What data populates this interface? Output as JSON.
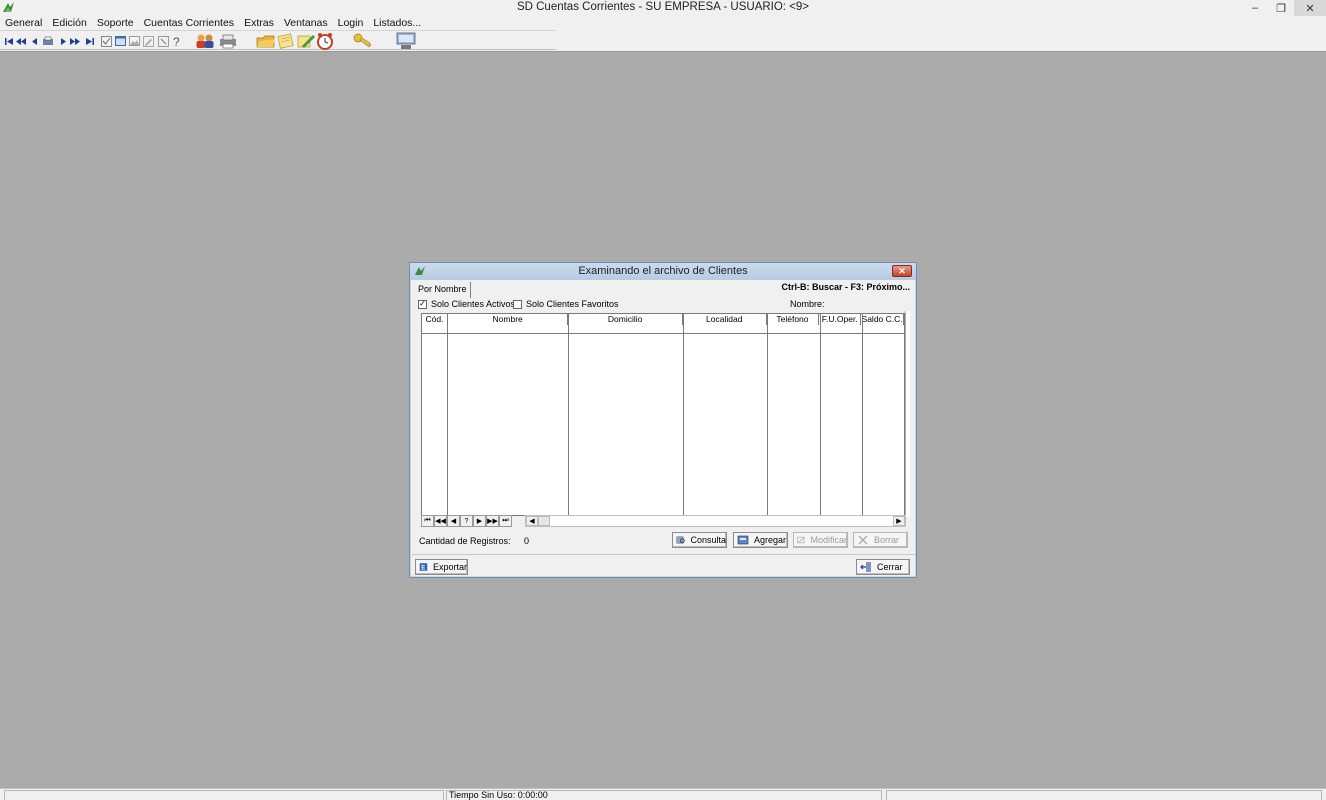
{
  "app": {
    "title": "SD Cuentas Corrientes - SU EMPRESA - USUARIO:  <9>",
    "icon": "app-logo-icon",
    "controls": {
      "minimize": "–",
      "restore": "❐",
      "close": "✕"
    }
  },
  "menu": {
    "items": [
      "General",
      "Edición",
      "Soporte",
      "Cuentas Corrientes",
      "Extras",
      "Ventanas",
      "Login",
      "Listados..."
    ]
  },
  "toolbar": {
    "icons": [
      "first-record-icon",
      "previous-page-icon",
      "previous-record-icon",
      "print-icon",
      "next-record-icon",
      "next-page-icon",
      "last-record-icon",
      "check-icon",
      "window-icon",
      "image-icon",
      "edit-icon",
      "zoom-icon",
      "help-icon",
      "clients-icon",
      "printer-icon",
      "folder-icon",
      "notes-icon",
      "pencil-icon",
      "clock-icon",
      "key-icon",
      "computer-icon"
    ]
  },
  "dialog": {
    "title": "Examinando el archivo de Clientes",
    "tab": "Por Nombre",
    "hotkeys": "Ctrl-B: Buscar - F3: Próximo...",
    "filters": [
      {
        "label": "Solo Clientes Activos",
        "checked": true
      },
      {
        "label": "Solo Clientes Favoritos",
        "checked": false
      }
    ],
    "name_label": "Nombre:",
    "columns": [
      "Cód.",
      "Nombre",
      "Domicilio",
      "Localidad",
      "Teléfono",
      "F.U.Oper.",
      "Saldo C.C."
    ],
    "nav": [
      "⏮",
      "◀◀",
      "◀",
      "?",
      "▶",
      "▶▶",
      "⏭"
    ],
    "count_label": "Cantidad de Registros:",
    "count_value": "0",
    "buttons": {
      "consulta": "Consulta",
      "agregar": "Agregar",
      "modificar": "Modificar",
      "borrar": "Borrar",
      "exportar": "Exportar",
      "cerrar": "Cerrar"
    }
  },
  "status": {
    "idle_time": "Tiempo Sin Uso:  0:00:00"
  },
  "colors": {
    "desktop": "#ababab",
    "dialog_border": "#6e8db0",
    "dialog_title": "#c9dbee",
    "close_red": "#c7412a"
  }
}
